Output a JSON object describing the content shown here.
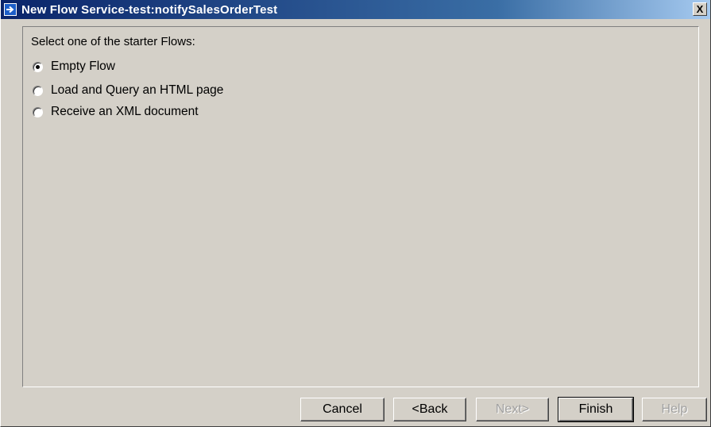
{
  "window": {
    "title": "New Flow Service-test:notifySalesOrderTest",
    "close_label": "X"
  },
  "content": {
    "prompt": "Select one of the starter Flows:",
    "options": [
      {
        "label": "Empty Flow",
        "selected": true
      },
      {
        "label": "Load and Query an HTML page",
        "selected": false
      },
      {
        "label": "Receive an XML document",
        "selected": false
      }
    ]
  },
  "buttons": {
    "cancel": "Cancel",
    "back": "<Back",
    "next": "Next>",
    "finish": "Finish",
    "help": "Help"
  },
  "colors": {
    "titlebar_start": "#0a246a",
    "titlebar_end": "#a6caf0",
    "dialog_bg": "#d4d0c8",
    "disabled_text": "#a0a0a0"
  },
  "icons": {
    "title_icon": "arrow-right-icon",
    "close_icon": "close-icon"
  }
}
